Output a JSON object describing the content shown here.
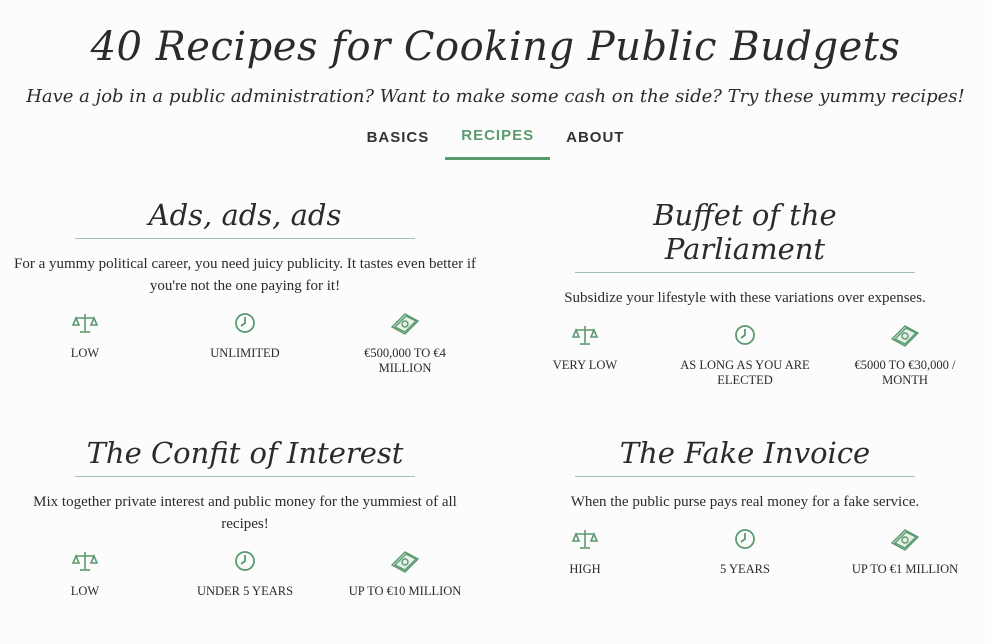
{
  "site": {
    "title": "40 Recipes for Cooking Public Budgets",
    "tagline": "Have a job in a public administration? Want to make some cash on the side? Try these yummy recipes!"
  },
  "nav": {
    "items": [
      {
        "label": "BASICS",
        "active": false
      },
      {
        "label": "RECIPES",
        "active": true
      },
      {
        "label": "ABOUT",
        "active": false
      }
    ]
  },
  "colors": {
    "accent": "#5a9a6e",
    "text": "#2b2b2b",
    "divider": "#9fc2ab"
  },
  "recipes": [
    {
      "title": "Ads, ads, ads",
      "description": "For a yummy political career, you need juicy publicity. It tastes even better if you're not the one paying for it!",
      "risk": "LOW",
      "duration": "UNLIMITED",
      "amount": "€500,000 TO €4 MILLION"
    },
    {
      "title": "Buffet of the Parliament",
      "description": "Subsidize your lifestyle with these variations over expenses.",
      "risk": "VERY LOW",
      "duration": "AS LONG AS YOU ARE ELECTED",
      "amount": "€5000 TO €30,000 / MONTH"
    },
    {
      "title": "The Confit of Interest",
      "description": "Mix together private interest and public money for the yummiest of all recipes!",
      "risk": "LOW",
      "duration": "UNDER 5 YEARS",
      "amount": "UP TO €10 MILLION"
    },
    {
      "title": "The Fake Invoice",
      "description": "When the public purse pays real money for a fake service.",
      "risk": "HIGH",
      "duration": "5 YEARS",
      "amount": "UP TO €1 MILLION"
    }
  ],
  "icons": {
    "risk": "scales-icon",
    "duration": "clock-icon",
    "amount": "banknotes-icon"
  }
}
